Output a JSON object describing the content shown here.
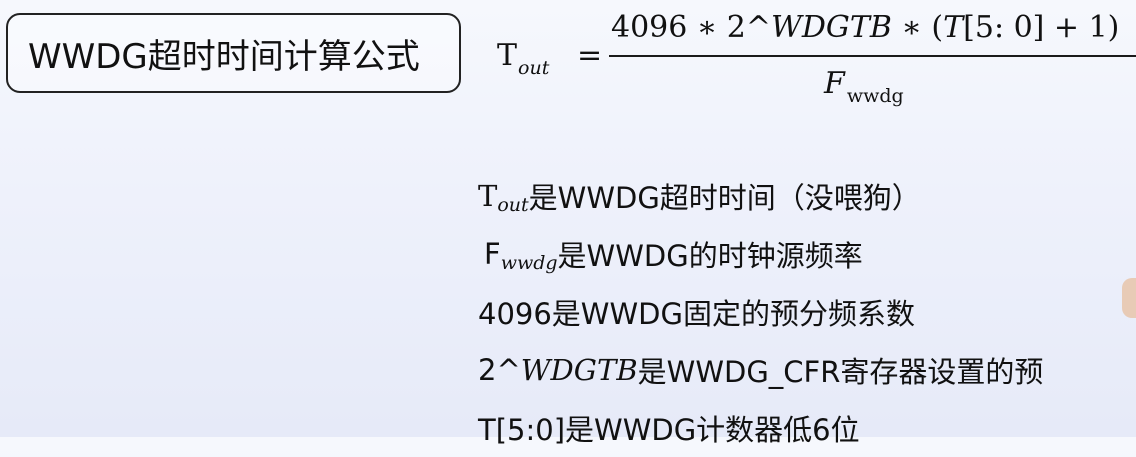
{
  "title": {
    "label": "WWDG超时时间计算公式"
  },
  "formula": {
    "lhs_main": "T",
    "lhs_sub": "out",
    "equals": "=",
    "numerator_prefix": "4096 ∗ 2^",
    "numerator_var": "WDGTB",
    "numerator_mid": " ∗ (",
    "numerator_t": "T",
    "numerator_suffix": "[5: 0] + 1)",
    "denominator_main": "F",
    "denominator_sub": "wwdg"
  },
  "lines": [
    {
      "math": "T",
      "sub": "out",
      "text": "是WWDG超时时间（没喂狗）"
    },
    {
      "math": "F",
      "sub": "wwdg",
      "text": "是WWDG的时钟源频率"
    },
    {
      "text": "4096是WWDG固定的预分频系数"
    },
    {
      "prefix": "2^",
      "var": "WDGTB",
      "text": "是WWDG_CFR寄存器设置的预"
    },
    {
      "text": "T[5:0]是WWDG计数器低6位"
    }
  ]
}
